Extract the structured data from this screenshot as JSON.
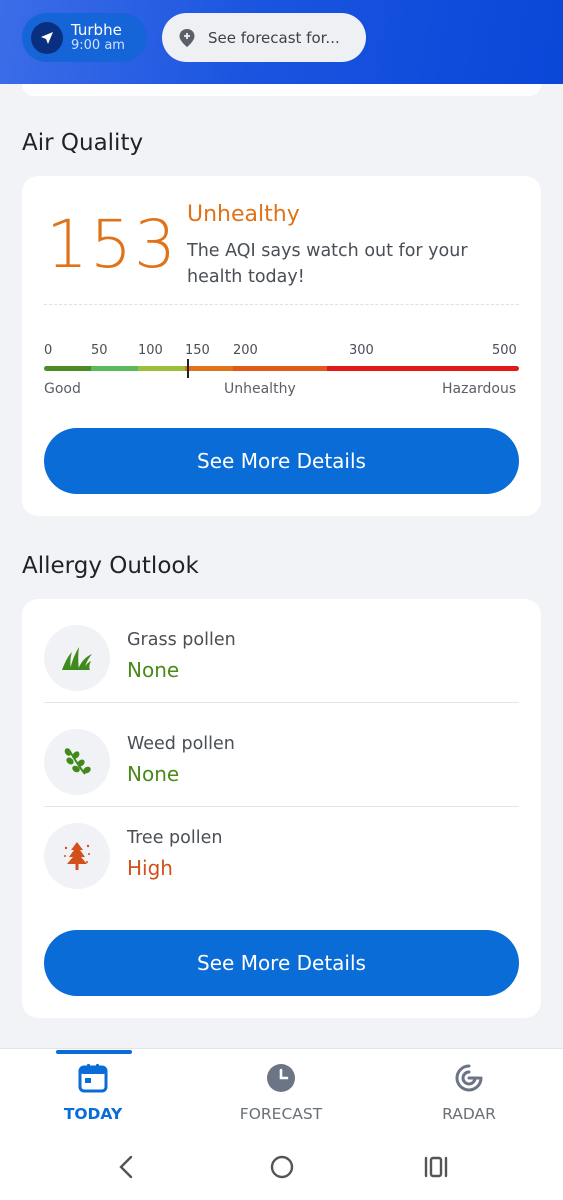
{
  "header": {
    "location_name": "Turbhe",
    "location_time": "9:00 am",
    "search_placeholder": "See forecast for..."
  },
  "air_quality": {
    "section_title": "Air Quality",
    "aqi_value": "153",
    "aqi_number": 153,
    "status": "Unhealthy",
    "description": "The AQI says watch out for your health today!",
    "scale_ticks": [
      "0",
      "50",
      "100",
      "150",
      "200",
      "300",
      "500"
    ],
    "scale_labels": {
      "good": "Good",
      "unhealthy": "Unhealthy",
      "hazardous": "Hazardous"
    },
    "button_label": "See More Details",
    "colors": {
      "accent": "#e0731a",
      "good": "#4c8c24",
      "moderate": "#5cb85c",
      "usg": "#9bbf3a",
      "unhealthy": "#e0731a",
      "very_unhealthy": "#e05a1a",
      "hazardous": "#e01a1a"
    }
  },
  "allergy": {
    "section_title": "Allergy Outlook",
    "items": [
      {
        "name": "Grass pollen",
        "level": "None",
        "icon": "grass-icon",
        "color": "#4a8a1a"
      },
      {
        "name": "Weed pollen",
        "level": "None",
        "icon": "weed-icon",
        "color": "#4a8a1a"
      },
      {
        "name": "Tree pollen",
        "level": "High",
        "icon": "tree-icon",
        "color": "#d2501a"
      }
    ],
    "button_label": "See More Details"
  },
  "bottom_nav": {
    "items": [
      {
        "label": "TODAY",
        "icon": "calendar-icon",
        "active": true
      },
      {
        "label": "FORECAST",
        "icon": "clock-icon",
        "active": false
      },
      {
        "label": "RADAR",
        "icon": "radar-icon",
        "active": false
      }
    ]
  },
  "system_nav": {
    "icons": [
      "back-icon",
      "home-icon",
      "recents-icon"
    ]
  }
}
